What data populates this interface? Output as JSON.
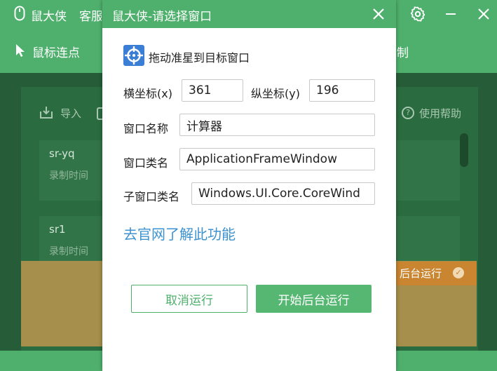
{
  "app": {
    "title": "鼠大侠",
    "service_label": "客服",
    "toolbar_left_label": "鼠标连点",
    "toolbar_right_label": "制",
    "actions": {
      "import_label": "导入",
      "help_label": "使用帮助"
    },
    "records": [
      {
        "name": "sr-yq",
        "time_label": "录制时间"
      },
      {
        "name": "sr1",
        "time_label": "录制时间"
      }
    ],
    "run_status_label": "后台运行",
    "icons": [
      "mouse-logo-icon",
      "gear-icon",
      "minimize-icon",
      "close-icon",
      "cursor-arrow-icon",
      "import-icon",
      "help-circle-icon",
      "check-icon"
    ]
  },
  "dialog": {
    "title": "鼠大侠-请选择窗口",
    "hint": "拖动准星到目标窗口",
    "x_label": "横坐标(x)",
    "x_value": "361",
    "y_label": "纵坐标(y)",
    "y_value": "196",
    "window_name_label": "窗口名称",
    "window_name_value": "计算器",
    "window_class_label": "窗口类名",
    "window_class_value": "ApplicationFrameWindow",
    "child_class_label": "子窗口类名",
    "child_class_value": "Windows.UI.Core.CoreWind",
    "learn_more_link": "去官网了解此功能",
    "cancel_label": "取消运行",
    "start_label": "开始后台运行",
    "icons": [
      "crosshair-icon",
      "close-icon"
    ]
  },
  "colors": {
    "accent_green": "#4fb06d",
    "dark_green": "#265d38",
    "link_blue": "#3d92cf",
    "crosshair_blue": "#3a7fd5",
    "status_orange": "#c9852f"
  }
}
